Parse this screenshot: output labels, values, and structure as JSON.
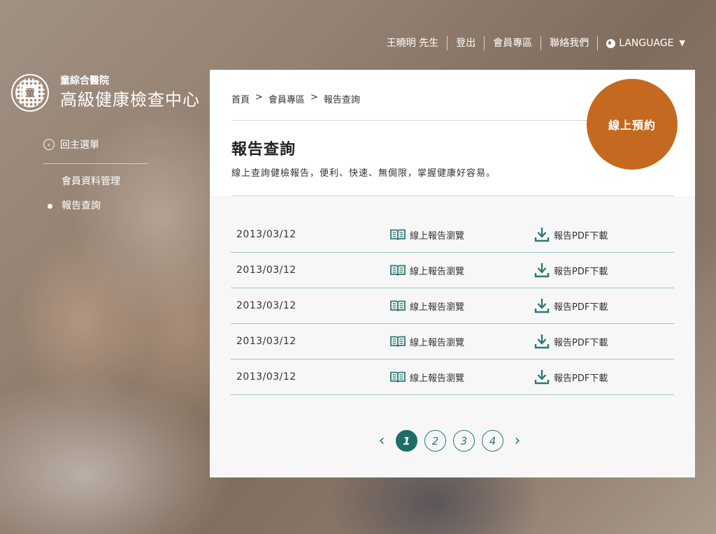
{
  "topnav": {
    "user": "王曉明 先生",
    "logout": "登出",
    "member_area": "會員專區",
    "contact": "聯絡我們",
    "language": "LANGUAGE"
  },
  "logo": {
    "mark": "童",
    "small": "童綜合醫院",
    "big": "高級健康檢查中心"
  },
  "sidebar": {
    "back": "回主選單",
    "items": [
      {
        "label": "會員資料管理",
        "active": false
      },
      {
        "label": "報告查詢",
        "active": true
      }
    ]
  },
  "breadcrumb": [
    "首頁",
    ">",
    "會員專區",
    ">",
    "報告查詢"
  ],
  "page": {
    "title": "報告查詢",
    "description": "線上查詢健檢報告，便利、快速、無侷限，掌握健康好容易。",
    "book_button": "線上預約"
  },
  "reports": [
    {
      "date": "2013/03/12",
      "view": "線上報告瀏覽",
      "pdf": "報告PDF下載"
    },
    {
      "date": "2013/03/12",
      "view": "線上報告瀏覽",
      "pdf": "報告PDF下載"
    },
    {
      "date": "2013/03/12",
      "view": "線上報告瀏覽",
      "pdf": "報告PDF下載"
    },
    {
      "date": "2013/03/12",
      "view": "線上報告瀏覽",
      "pdf": "報告PDF下載"
    },
    {
      "date": "2013/03/12",
      "view": "線上報告瀏覽",
      "pdf": "報告PDF下載"
    }
  ],
  "pagination": {
    "prev": "‹",
    "next": "›",
    "pages": [
      "1",
      "2",
      "3",
      "4"
    ],
    "current": "1"
  },
  "colors": {
    "accent": "#1e6e66",
    "book_button": "#c4691f",
    "row_line": "#9ec3c5"
  }
}
